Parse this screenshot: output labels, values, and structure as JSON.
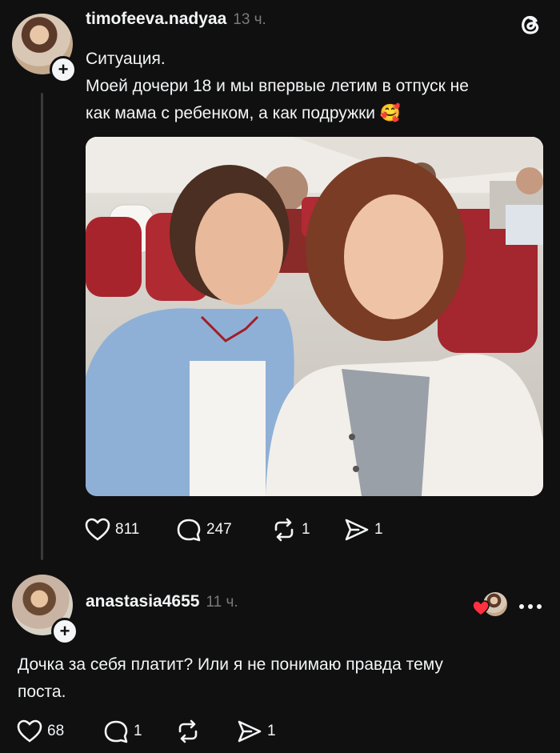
{
  "post": {
    "username": "timofeeva.nadyaa",
    "time": "13 ч.",
    "lines": [
      "Ситуация.",
      "Моей дочери 18 и мы впервые летим в отпуск не",
      "как мама с ребенком, а как подружки 🥰"
    ],
    "likes": "811",
    "comments": "247",
    "reposts": "1",
    "shares": "1"
  },
  "reply": {
    "username": "anastasia4655",
    "time": "11 ч.",
    "lines": [
      "Дочка за себя платит? Или я не понимаю правда тему",
      "поста."
    ],
    "likes": "68",
    "comments": "1",
    "shares": "1"
  },
  "icons": {
    "app_logo": "threads-logo-icon",
    "like": "heart-icon",
    "comment": "comment-bubble-icon",
    "repost": "repost-icon",
    "share": "send-icon",
    "more": "more-dots-icon"
  },
  "colors": {
    "background": "#101010",
    "text": "#f3f5f7",
    "muted": "#7a7a7a",
    "heart": "#ff3040"
  }
}
